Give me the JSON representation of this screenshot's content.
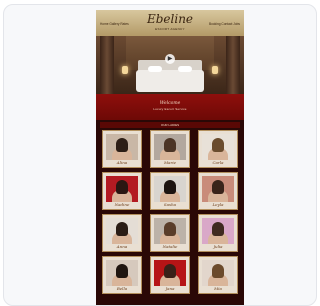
{
  "site": {
    "logo": "Ebeline",
    "logo_sub": "ESCORT AGENCY",
    "nav_left": "Home  Gallery  Rates",
    "nav_right": "Booking  Contact  Jobs"
  },
  "hero": {
    "play_icon": "play-icon"
  },
  "banner": {
    "title": "Welcome",
    "subtitle": "Luxury Escort Service"
  },
  "section_title": "OUR LADIES",
  "models": [
    {
      "name": "Alina",
      "bg": "#c9b7a6",
      "hair": "#2d1e16"
    },
    {
      "name": "Marie",
      "bg": "#b2a79e",
      "hair": "#4b3426"
    },
    {
      "name": "Carla",
      "bg": "#e8e1d8",
      "hair": "#6a4c2e"
    },
    {
      "name": "Nadine",
      "bg": "#b31b22",
      "hair": "#2a1712"
    },
    {
      "name": "Sasha",
      "bg": "#d8d4cf",
      "hair": "#1d1411"
    },
    {
      "name": "Leyla",
      "bg": "#c98c7a",
      "hair": "#3a241a"
    },
    {
      "name": "Anna",
      "bg": "#e4ddd5",
      "hair": "#2a1c15"
    },
    {
      "name": "Natalie",
      "bg": "#bcb2a8",
      "hair": "#5a3d2a"
    },
    {
      "name": "Julia",
      "bg": "#d9a8c8",
      "hair": "#3f2a20"
    },
    {
      "name": "Bella",
      "bg": "#d6c9bd",
      "hair": "#1f1510"
    },
    {
      "name": "Jana",
      "bg": "#b61416",
      "hair": "#3a2018"
    },
    {
      "name": "Mia",
      "bg": "#e2d6cc",
      "hair": "#6b4a2c"
    }
  ]
}
